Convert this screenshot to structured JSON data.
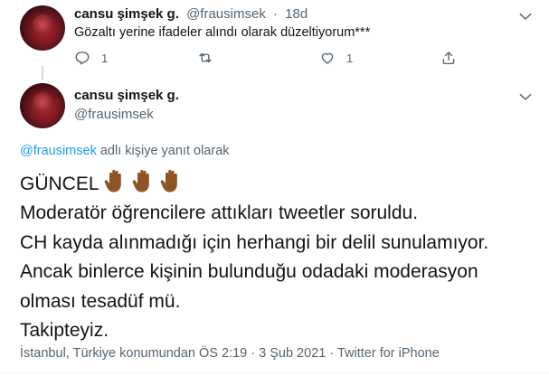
{
  "tweet1": {
    "display_name": "cansu şimşek g.",
    "handle": "@frausimsek",
    "separator": "·",
    "time": "18d",
    "text": "Gözaltı yerine ifadeler alındı olarak düzeltiyorum***",
    "actions": {
      "reply_count": "1",
      "retweet_count": "",
      "like_count": "1"
    }
  },
  "tweet2": {
    "display_name": "cansu şimşek g.",
    "handle": "@frausimsek",
    "reply_to": {
      "mention": "@frausimsek",
      "suffix": " adlı kişiye yanıt olarak"
    },
    "lines": [
      "GÜNCEL",
      "Moderatör öğrencilere attıkları tweetler soruldu.",
      "CH kayda alınmadığı için herhangi bir delil sunulamıyor.",
      "Ancak binlerce kişinin bulunduğu odadaki moderasyon",
      "olması tesadüf mü.",
      "Takipteyiz."
    ],
    "emoji": [
      "raised-hand-medium-dark-skin",
      "raised-hand-medium-dark-skin",
      "raised-hand-medium-dark-skin"
    ],
    "meta": {
      "location": "İstanbul, Türkiye konumundan",
      "time": "ÖS 2:19",
      "date": "3 Şub 2021",
      "source": "Twitter for iPhone",
      "dot": "·"
    }
  },
  "colors": {
    "text": "#0f1419",
    "muted": "#536471",
    "accent": "#1d9bf0",
    "hand": "#8d5524"
  },
  "icons": {
    "caret": "chevron-down-icon",
    "reply": "reply-icon",
    "retweet": "retweet-icon",
    "like": "heart-icon",
    "share": "share-icon"
  }
}
